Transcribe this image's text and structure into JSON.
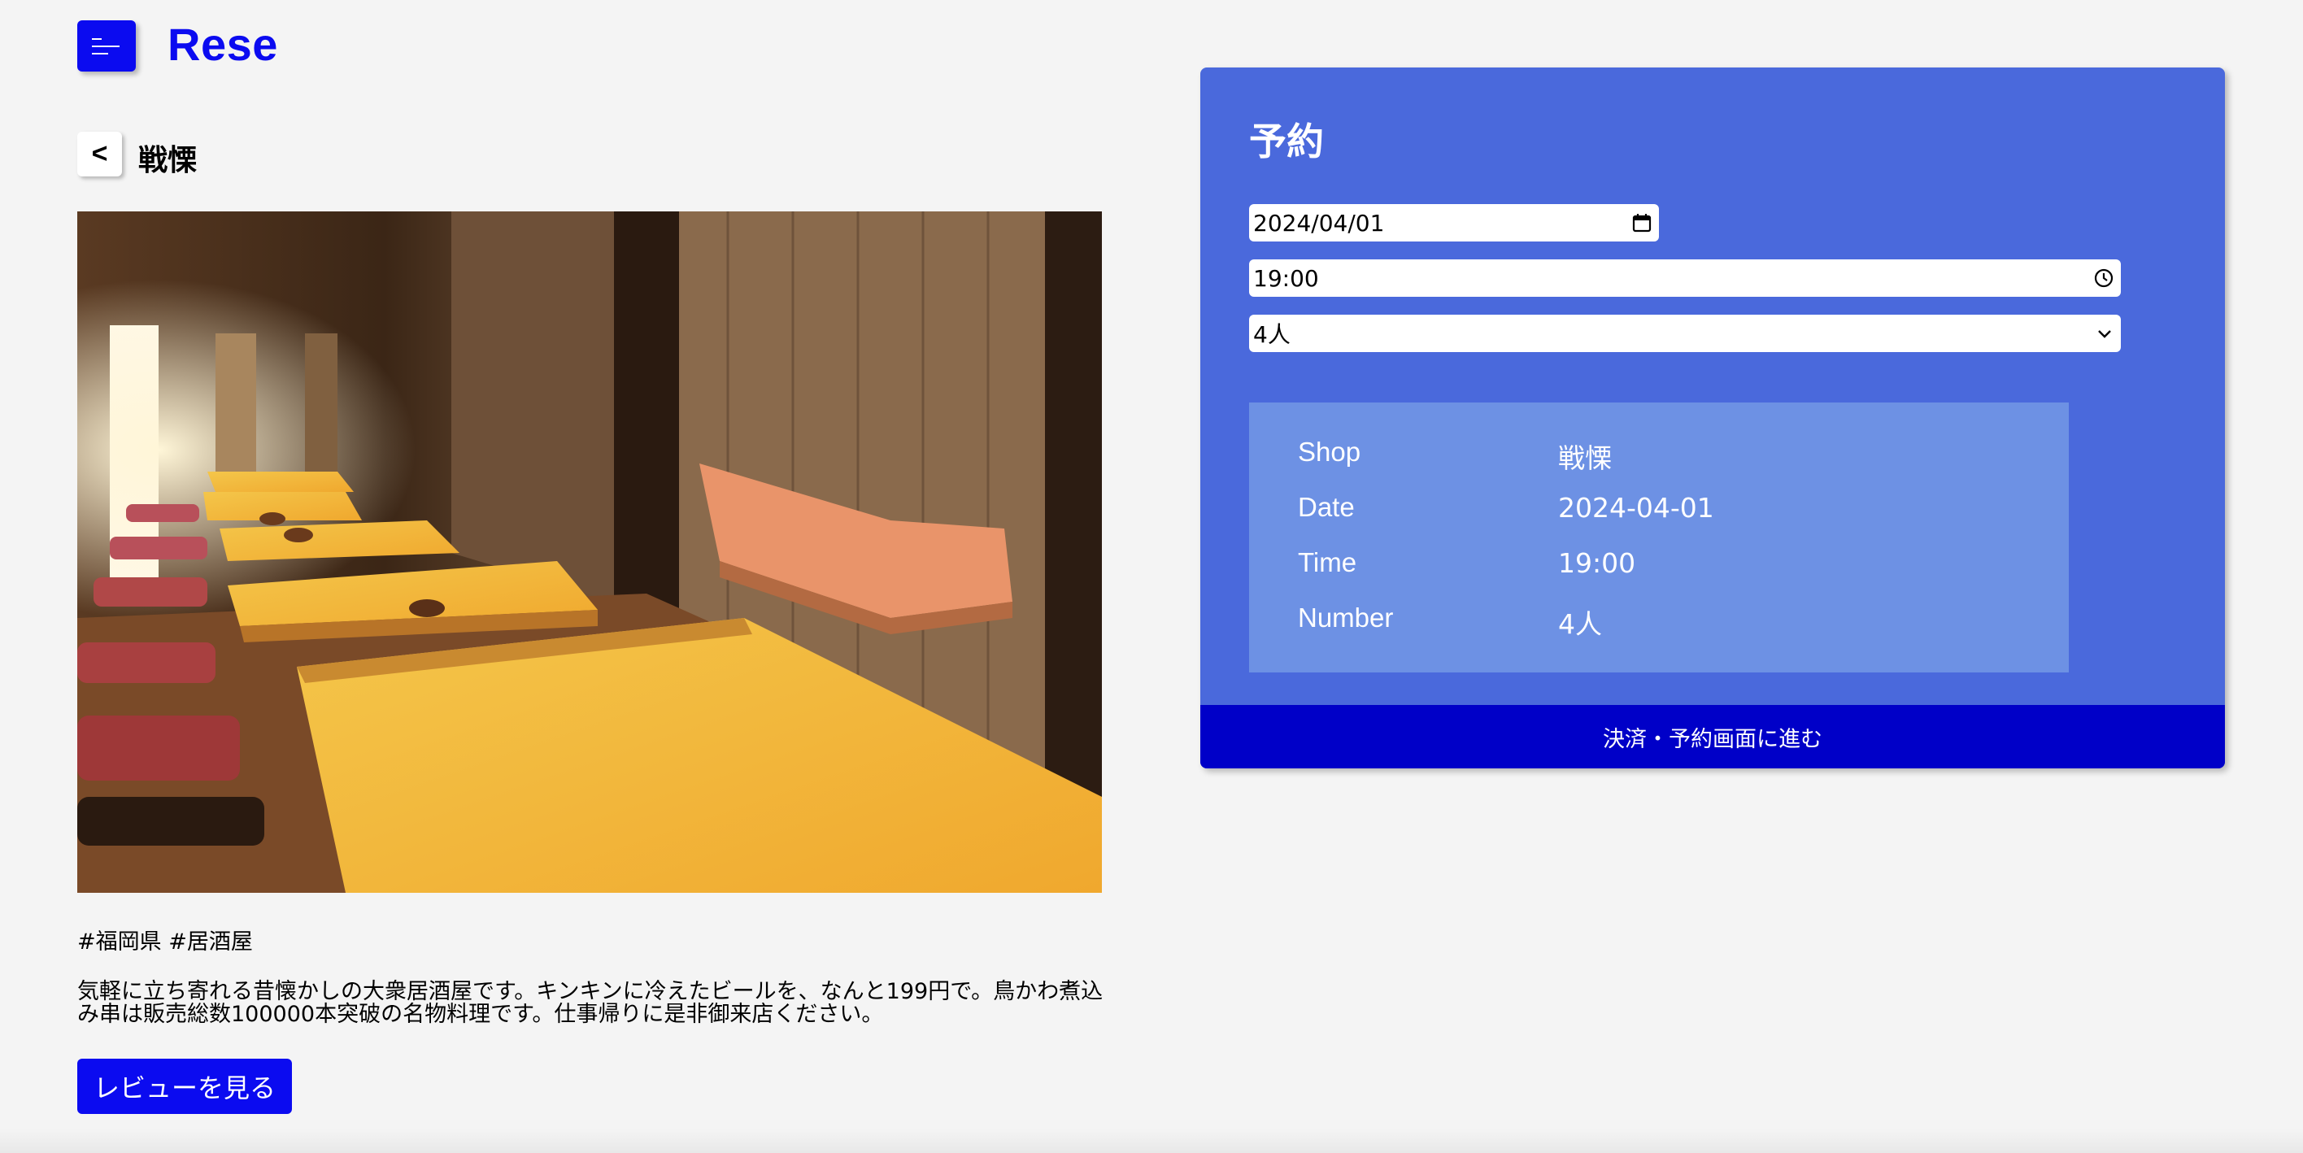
{
  "header": {
    "logo": "Rese",
    "menu_icon": "menu-icon"
  },
  "shop": {
    "back_label": "<",
    "name": "戦慄",
    "tags": "#福岡県 #居酒屋",
    "description": "気軽に立ち寄れる昔懐かしの大衆居酒屋です。キンキンに冷えたビールを、なんと199円で。鳥かわ煮込み串は販売総数100000本突破の名物料理です。仕事帰りに是非御来店ください。",
    "review_button": "レビューを見る"
  },
  "reservation": {
    "title": "予約",
    "date_value": "2024/04/01",
    "time_value": "19:00",
    "number_value": "4人",
    "summary": [
      {
        "key": "Shop",
        "value": "戦慄"
      },
      {
        "key": "Date",
        "value": "2024-04-01"
      },
      {
        "key": "Time",
        "value": "19:00"
      },
      {
        "key": "Number",
        "value": "4人"
      }
    ],
    "submit_label": "決済・予約画面に進む"
  },
  "colors": {
    "accent": "#0b0bf0",
    "panel": "#4a69dc",
    "summary_box": "#6d91e4",
    "submit": "#0000c8",
    "background": "#f4f4f4"
  }
}
